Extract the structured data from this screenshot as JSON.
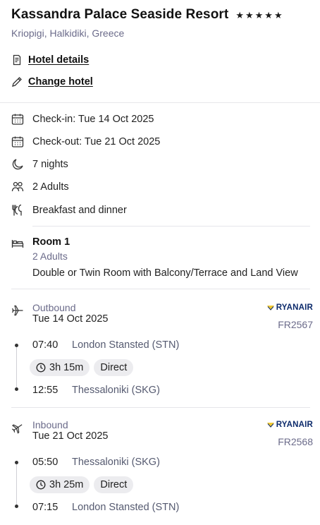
{
  "hotel": {
    "name": "Kassandra Palace Seaside Resort",
    "stars": 5,
    "location": "Kriopigi, Halkidiki, Greece"
  },
  "actions": {
    "details_label": "Hotel details",
    "change_label": "Change hotel"
  },
  "stay": {
    "checkin": "Check-in: Tue 14 Oct 2025",
    "checkout": "Check-out: Tue 21 Oct 2025",
    "nights": "7 nights",
    "guests": "2 Adults",
    "board": "Breakfast and dinner"
  },
  "room": {
    "title": "Room 1",
    "guests": "2 Adults",
    "description": "Double or Twin Room with Balcony/Terrace and Land View"
  },
  "outbound": {
    "label": "Outbound",
    "date": "Tue 14 Oct 2025",
    "airline": "RYANAIR",
    "flight_no": "FR2567",
    "depart_time": "07:40",
    "depart_place": "London Stansted (STN)",
    "duration": "3h 15m",
    "stops": "Direct",
    "arrive_time": "12:55",
    "arrive_place": "Thessaloniki (SKG)"
  },
  "inbound": {
    "label": "Inbound",
    "date": "Tue 21 Oct 2025",
    "airline": "RYANAIR",
    "flight_no": "FR2568",
    "depart_time": "05:50",
    "depart_place": "Thessaloniki (SKG)",
    "duration": "3h 25m",
    "stops": "Direct",
    "arrive_time": "07:15",
    "arrive_place": "London Stansted (STN)"
  },
  "colors": {
    "text": "#1a1a1a",
    "muted": "#6b6b8a",
    "chip_bg": "#ececef",
    "divider": "#e6e6ea",
    "airline_blue": "#0c2a6b",
    "airline_yellow": "#f1c933"
  }
}
